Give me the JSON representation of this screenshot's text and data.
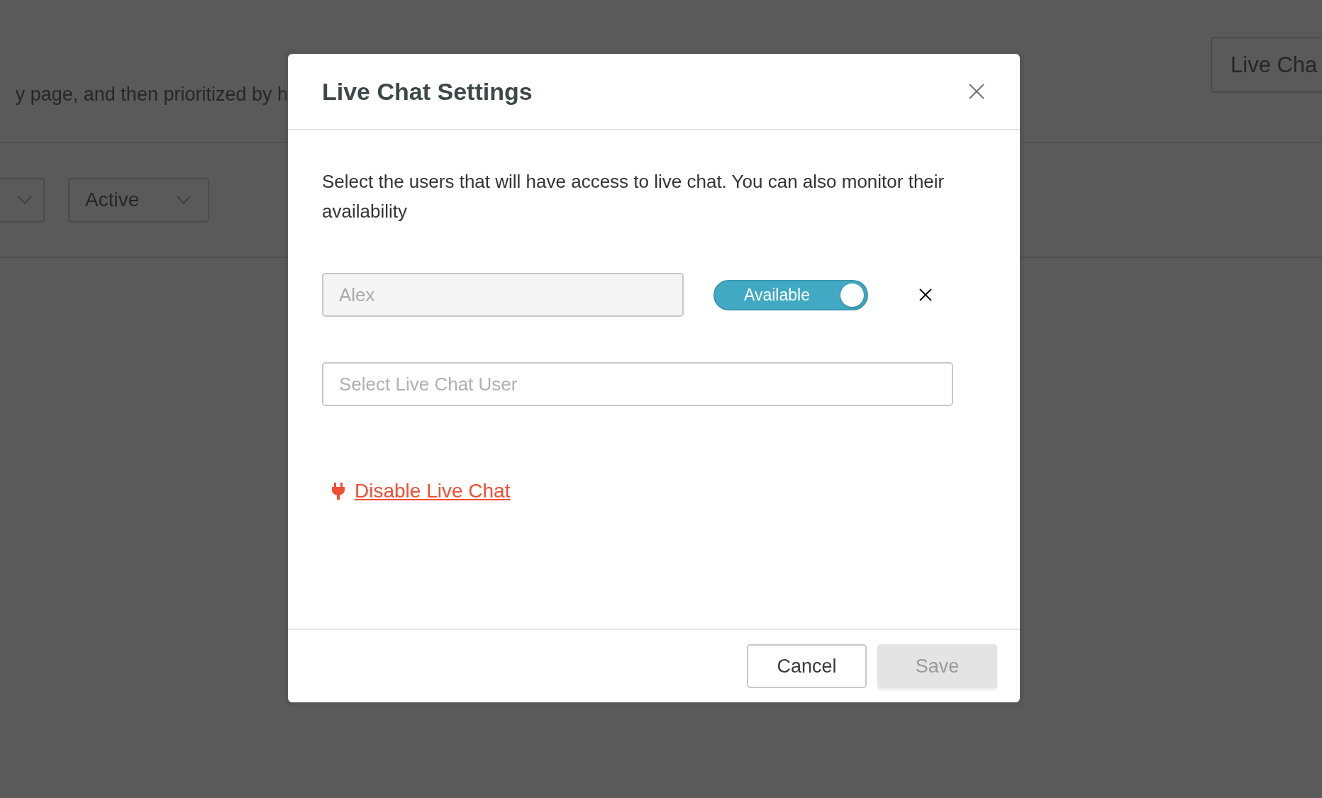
{
  "background": {
    "description_fragment": "y page, and then prioritized by h",
    "filter": {
      "value": "Active"
    },
    "header_button": {
      "label": "Live Cha"
    }
  },
  "modal": {
    "title": "Live Chat Settings",
    "description": "Select the users that will have access to live chat. You can also monitor their availability",
    "users": [
      {
        "name": "Alex",
        "status": {
          "label": "Available",
          "on": true
        }
      }
    ],
    "user_select": {
      "placeholder": "Select Live Chat User"
    },
    "disable_link": "Disable Live Chat",
    "buttons": [
      {
        "kind": "secondary",
        "label": "Cancel",
        "disabled": false
      },
      {
        "kind": "primary",
        "label": "Save",
        "disabled": true
      }
    ]
  }
}
